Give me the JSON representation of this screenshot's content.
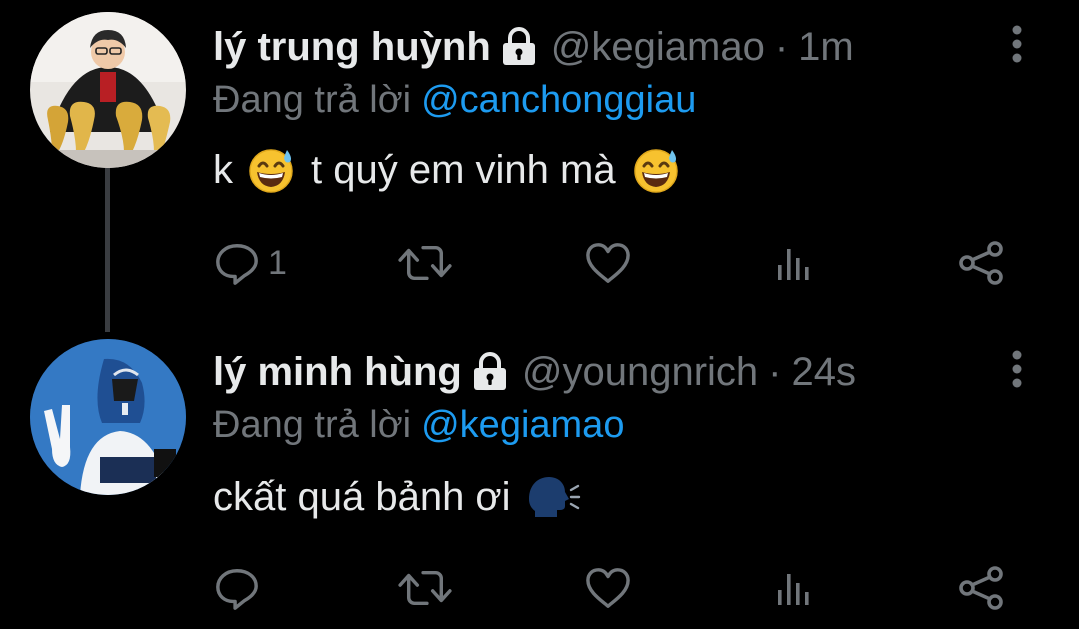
{
  "colors": {
    "background": "#000000",
    "text_primary": "#e7e9ea",
    "text_secondary": "#71767b",
    "accent": "#1d9bf0",
    "thread_line": "#3a3d41"
  },
  "tweets": [
    {
      "display_name": "lý trung huỳnh",
      "protected_icon": "lock-icon",
      "handle": "@kegiamao",
      "separator": "·",
      "time": "1m",
      "replying_label": "Đang trả lời",
      "replying_to": "@canchonggiau",
      "text_parts": [
        "k",
        "t quý em vinh mà"
      ],
      "emojis": [
        "grinning-sweat-emoji",
        "grinning-sweat-emoji"
      ],
      "reply_count": "1",
      "icons": [
        "reply-icon",
        "retweet-icon",
        "like-icon",
        "views-icon",
        "share-icon",
        "more-icon"
      ]
    },
    {
      "display_name": "lý minh hùng",
      "protected_icon": "lock-icon",
      "handle": "@youngnrich",
      "separator": "·",
      "time": "24s",
      "replying_label": "Đang trả lời",
      "replying_to": "@kegiamao",
      "text_parts": [
        "ckất quá bảnh ơi"
      ],
      "emojis": [
        "speaking-head-emoji"
      ],
      "reply_count": "",
      "icons": [
        "reply-icon",
        "retweet-icon",
        "like-icon",
        "views-icon",
        "share-icon",
        "more-icon"
      ]
    }
  ]
}
